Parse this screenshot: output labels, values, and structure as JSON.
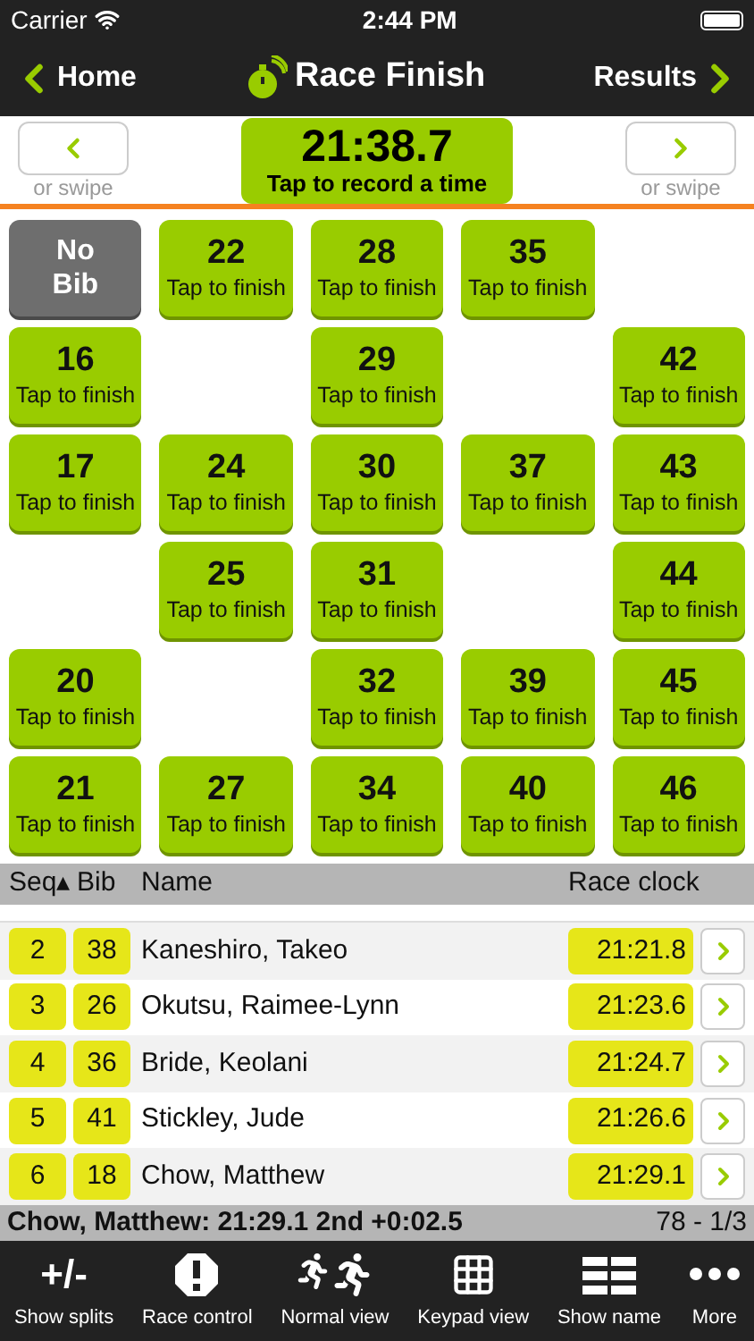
{
  "status_bar": {
    "carrier": "Carrier",
    "time": "2:44 PM"
  },
  "nav": {
    "back": "Home",
    "title": "Race Finish",
    "forward": "Results"
  },
  "timer": {
    "time": "21:38.7",
    "hint": "Tap to record a time",
    "prev_hint": "or swipe",
    "next_hint": "or swipe"
  },
  "tiles": [
    {
      "kind": "no_bib",
      "label": "No Bib"
    },
    {
      "kind": "bib",
      "bib": "22",
      "hint": "Tap to finish"
    },
    {
      "kind": "bib",
      "bib": "28",
      "hint": "Tap to finish"
    },
    {
      "kind": "bib",
      "bib": "35",
      "hint": "Tap to finish"
    },
    {
      "kind": "empty"
    },
    {
      "kind": "bib",
      "bib": "16",
      "hint": "Tap to finish"
    },
    {
      "kind": "empty"
    },
    {
      "kind": "bib",
      "bib": "29",
      "hint": "Tap to finish"
    },
    {
      "kind": "empty"
    },
    {
      "kind": "bib",
      "bib": "42",
      "hint": "Tap to finish"
    },
    {
      "kind": "bib",
      "bib": "17",
      "hint": "Tap to finish"
    },
    {
      "kind": "bib",
      "bib": "24",
      "hint": "Tap to finish"
    },
    {
      "kind": "bib",
      "bib": "30",
      "hint": "Tap to finish"
    },
    {
      "kind": "bib",
      "bib": "37",
      "hint": "Tap to finish"
    },
    {
      "kind": "bib",
      "bib": "43",
      "hint": "Tap to finish"
    },
    {
      "kind": "empty"
    },
    {
      "kind": "bib",
      "bib": "25",
      "hint": "Tap to finish"
    },
    {
      "kind": "bib",
      "bib": "31",
      "hint": "Tap to finish"
    },
    {
      "kind": "empty"
    },
    {
      "kind": "bib",
      "bib": "44",
      "hint": "Tap to finish"
    },
    {
      "kind": "bib",
      "bib": "20",
      "hint": "Tap to finish"
    },
    {
      "kind": "empty"
    },
    {
      "kind": "bib",
      "bib": "32",
      "hint": "Tap to finish"
    },
    {
      "kind": "bib",
      "bib": "39",
      "hint": "Tap to finish"
    },
    {
      "kind": "bib",
      "bib": "45",
      "hint": "Tap to finish"
    },
    {
      "kind": "bib",
      "bib": "21",
      "hint": "Tap to finish"
    },
    {
      "kind": "bib",
      "bib": "27",
      "hint": "Tap to finish"
    },
    {
      "kind": "bib",
      "bib": "34",
      "hint": "Tap to finish"
    },
    {
      "kind": "bib",
      "bib": "40",
      "hint": "Tap to finish"
    },
    {
      "kind": "bib",
      "bib": "46",
      "hint": "Tap to finish"
    }
  ],
  "table": {
    "columns": [
      "Seq▴",
      "Bib",
      "Name",
      "Race clock"
    ],
    "rows": [
      {
        "seq": "2",
        "bib": "38",
        "name": "Kaneshiro, Takeo",
        "clock": "21:21.8"
      },
      {
        "seq": "3",
        "bib": "26",
        "name": "Okutsu, Raimee-Lynn",
        "clock": "21:23.6"
      },
      {
        "seq": "4",
        "bib": "36",
        "name": "Bride, Keolani",
        "clock": "21:24.7"
      },
      {
        "seq": "5",
        "bib": "41",
        "name": "Stickley, Jude",
        "clock": "21:26.6"
      },
      {
        "seq": "6",
        "bib": "18",
        "name": "Chow, Matthew",
        "clock": "21:29.1"
      }
    ]
  },
  "summary": {
    "text": "Chow, Matthew: 21:29.1 2nd +0:02.5",
    "count": "78 - 1/3"
  },
  "toolbar": [
    {
      "kind": "splits",
      "glyph": "+/-",
      "label": "Show splits"
    },
    {
      "kind": "alert",
      "label": "Race control"
    },
    {
      "kind": "runners",
      "label": "Normal view"
    },
    {
      "kind": "keypad",
      "label": "Keypad view"
    },
    {
      "kind": "names",
      "label": "Show name"
    },
    {
      "kind": "more",
      "label": "More"
    }
  ]
}
